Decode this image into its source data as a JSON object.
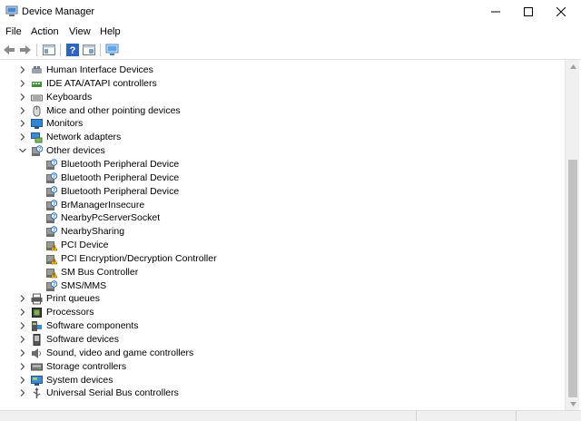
{
  "window": {
    "title": "Device Manager"
  },
  "menu": [
    "File",
    "Action",
    "View",
    "Help"
  ],
  "toolbar_icons": [
    "back-arrow-icon",
    "forward-arrow-icon",
    "properties-icon",
    "help-icon",
    "update-driver-icon",
    "scan-hardware-icon"
  ],
  "tree": [
    {
      "label": "Human Interface Devices",
      "level": 0,
      "expanded": false,
      "icon": "hid-icon"
    },
    {
      "label": "IDE ATA/ATAPI controllers",
      "level": 0,
      "expanded": false,
      "icon": "ide-icon"
    },
    {
      "label": "Keyboards",
      "level": 0,
      "expanded": false,
      "icon": "keyboard-icon"
    },
    {
      "label": "Mice and other pointing devices",
      "level": 0,
      "expanded": false,
      "icon": "mouse-icon"
    },
    {
      "label": "Monitors",
      "level": 0,
      "expanded": false,
      "icon": "monitor-icon"
    },
    {
      "label": "Network adapters",
      "level": 0,
      "expanded": false,
      "icon": "network-icon"
    },
    {
      "label": "Other devices",
      "level": 0,
      "expanded": true,
      "icon": "unknown-device-icon"
    },
    {
      "label": "Bluetooth Peripheral Device",
      "level": 1,
      "icon": "unknown-device-icon"
    },
    {
      "label": "Bluetooth Peripheral Device",
      "level": 1,
      "icon": "unknown-device-icon"
    },
    {
      "label": "Bluetooth Peripheral Device",
      "level": 1,
      "icon": "unknown-device-icon"
    },
    {
      "label": "BrManagerInsecure",
      "level": 1,
      "icon": "unknown-device-icon"
    },
    {
      "label": "NearbyPcServerSocket",
      "level": 1,
      "icon": "unknown-device-icon"
    },
    {
      "label": "NearbySharing",
      "level": 1,
      "icon": "unknown-device-icon"
    },
    {
      "label": "PCI Device",
      "level": 1,
      "icon": "warning-device-icon"
    },
    {
      "label": "PCI Encryption/Decryption Controller",
      "level": 1,
      "icon": "warning-device-icon"
    },
    {
      "label": "SM Bus Controller",
      "level": 1,
      "icon": "warning-device-icon"
    },
    {
      "label": "SMS/MMS",
      "level": 1,
      "icon": "unknown-device-icon"
    },
    {
      "label": "Print queues",
      "level": 0,
      "expanded": false,
      "icon": "printer-icon"
    },
    {
      "label": "Processors",
      "level": 0,
      "expanded": false,
      "icon": "processor-icon"
    },
    {
      "label": "Software components",
      "level": 0,
      "expanded": false,
      "icon": "software-component-icon"
    },
    {
      "label": "Software devices",
      "level": 0,
      "expanded": false,
      "icon": "software-device-icon"
    },
    {
      "label": "Sound, video and game controllers",
      "level": 0,
      "expanded": false,
      "icon": "speaker-icon"
    },
    {
      "label": "Storage controllers",
      "level": 0,
      "expanded": false,
      "icon": "storage-icon"
    },
    {
      "label": "System devices",
      "level": 0,
      "expanded": false,
      "icon": "system-device-icon"
    },
    {
      "label": "Universal Serial Bus controllers",
      "level": 0,
      "expanded": false,
      "icon": "usb-icon"
    }
  ],
  "colors": {
    "accent": "#1e6ec8",
    "warning": "#f5c400",
    "text": "#000000"
  }
}
